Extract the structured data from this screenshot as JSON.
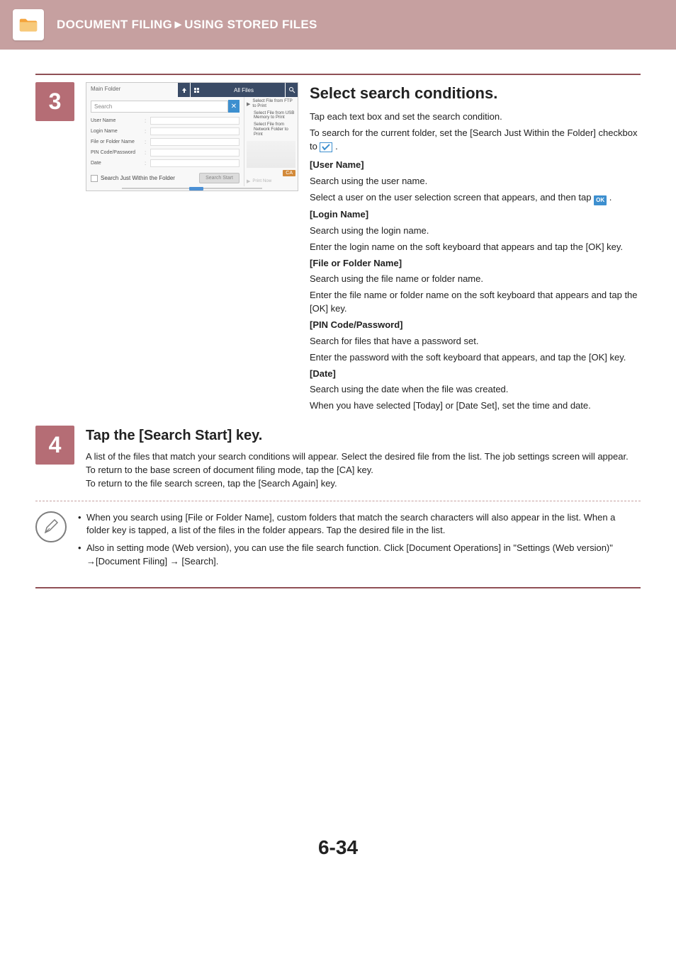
{
  "header": {
    "title": "DOCUMENT FILING►USING STORED FILES"
  },
  "step3": {
    "number": "3",
    "mock": {
      "main_folder": "Main Folder",
      "all_files": "All Files",
      "search_placeholder": "Search",
      "fields": {
        "user_name": "User Name",
        "login_name": "Login Name",
        "file_or_folder": "File or Folder Name",
        "pin": "PIN Code/Password",
        "date": "Date"
      },
      "search_within": "Search Just Within the Folder",
      "search_start": "Search Start",
      "right": {
        "ftp": "Select File from FTP to Print",
        "usb": "Select File from USB Memory to Print",
        "net": "Select File from Network Folder to Print"
      },
      "ca": "CA",
      "print_now": "Print Now"
    },
    "heading": "Select search conditions.",
    "p1": "Tap each text box and set the search condition.",
    "p2a": "To search for the current folder, set the [Search Just Within the Folder] checkbox to ",
    "p2b": ".",
    "user_name_h": "[User Name]",
    "user_name_1": "Search using the user name.",
    "user_name_2a": "Select a user on the user selection screen that appears, and then tap ",
    "user_name_2b": ".",
    "ok_label": "OK",
    "login_h": "[Login Name]",
    "login_1": "Search using the login name.",
    "login_2": "Enter the login name on the soft keyboard that appears and tap the [OK] key.",
    "file_h": "[File or Folder Name]",
    "file_1": "Search using the file name or folder name.",
    "file_2": "Enter the file name or folder name on the soft keyboard that appears and tap the [OK] key.",
    "pin_h": "[PIN Code/Password]",
    "pin_1": "Search for files that have a password set.",
    "pin_2": "Enter the password with the soft keyboard that appears, and tap the [OK] key.",
    "date_h": "[Date]",
    "date_1": "Search using the date when the file was created.",
    "date_2": "When you have selected [Today] or [Date Set], set the time and date."
  },
  "step4": {
    "number": "4",
    "heading": "Tap the [Search Start] key.",
    "p1": "A list of the files that match your search conditions will appear. Select the desired file from the list. The job settings screen will appear.",
    "p2": "To return to the base screen of document filing mode, tap the [CA] key.",
    "p3": "To return to the file search screen, tap the [Search Again] key."
  },
  "notes": {
    "n1": "When you search using [File or Folder Name], custom folders that match the search characters will also appear in the list. When a folder key is tapped, a list of the files in the folder appears. Tap the desired file in the list.",
    "n2": "Also in setting mode (Web version), you can use the file search function. Click [Document Operations] in \"Settings (Web version)\" →[Document Filing] → [Search]."
  },
  "page_number": "6-34"
}
